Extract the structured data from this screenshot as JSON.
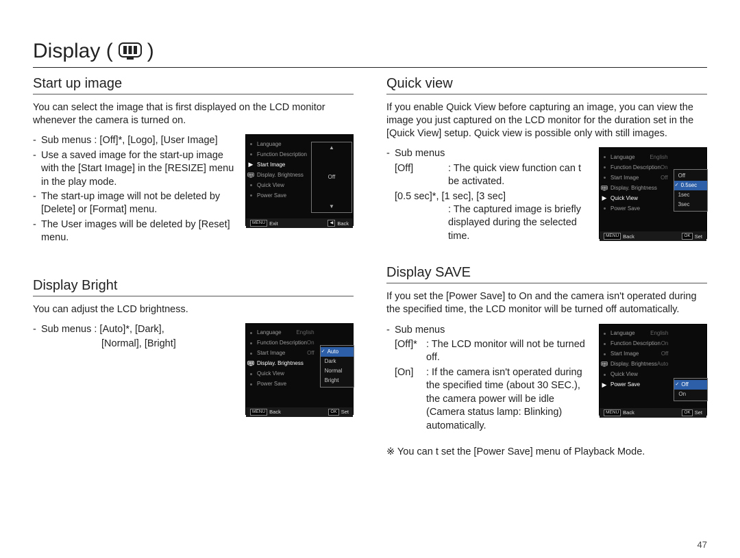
{
  "page_title_prefix": "Display (",
  "page_title_suffix": " )",
  "page_number": "47",
  "sections": {
    "start_up": {
      "title": "Start up image",
      "intro": "You can select the image that is first displayed on the LCD monitor whenever the camera is turned on.",
      "items": [
        "Sub menus : [Off]*, [Logo], [User Image]",
        "Use a saved image for the start-up image with the [Start Image] in the [RESIZE] menu in the play mode.",
        "The start-up image will not be deleted by [Delete] or [Format] menu.",
        "The User images will be deleted by [Reset] menu."
      ]
    },
    "bright": {
      "title": "Display Bright",
      "intro": "You can adjust the LCD brightness.",
      "item1": "Sub menus : [Auto]*, [Dark],",
      "item1b": "[Normal], [Bright]"
    },
    "quick": {
      "title": "Quick view",
      "intro": "If you enable Quick View before capturing an image, you can view the image you just captured on the LCD monitor for the duration set in the [Quick View] setup. Quick view is possible only with still images.",
      "sub_label": "Sub menus",
      "off_label": "[Off]",
      "off_desc": ": The quick view function can t be activated.",
      "times_label": "[0.5 sec]*, [1 sec], [3 sec]",
      "times_desc": ": The captured image is briefly displayed during the selected time."
    },
    "save": {
      "title": "Display SAVE",
      "intro": "If you set the [Power Save] to On and the camera isn't operated during the specified time, the LCD monitor will be turned off automatically.",
      "sub_label": "Sub menus",
      "off_label": "[Off]*",
      "off_desc": ": The LCD monitor will not be turned off.",
      "on_label": "[On]",
      "on_desc": ": If the camera isn't operated during the specified time (about 30 SEC.), the camera power will be idle (Camera status lamp: Blinking) automatically.",
      "note": "※ You can t set the [Power Save] menu of Playback Mode."
    }
  },
  "menu": {
    "rows": {
      "language": "Language",
      "func_desc": "Function Description",
      "start_image": "Start Image",
      "display_bright": "Display. Brightness",
      "quick_view": "Quick View",
      "power_save": "Power Save"
    },
    "vals": {
      "english": "English",
      "on": "On",
      "off": "Off",
      "auto": "Auto"
    },
    "start_opts": {
      "off": "Off"
    },
    "bright_opts": {
      "auto": "Auto",
      "dark": "Dark",
      "normal": "Normal",
      "bright": "Bright"
    },
    "quick_opts": {
      "off": "Off",
      "s05": "0.5sec",
      "s1": "1sec",
      "s3": "3sec"
    },
    "save_opts": {
      "off": "Off",
      "on": "On"
    },
    "footer": {
      "menu_key": "MENU",
      "ok_key": "OK",
      "tri_key": "◀",
      "exit": "Exit",
      "back": "Back",
      "set": "Set"
    }
  }
}
